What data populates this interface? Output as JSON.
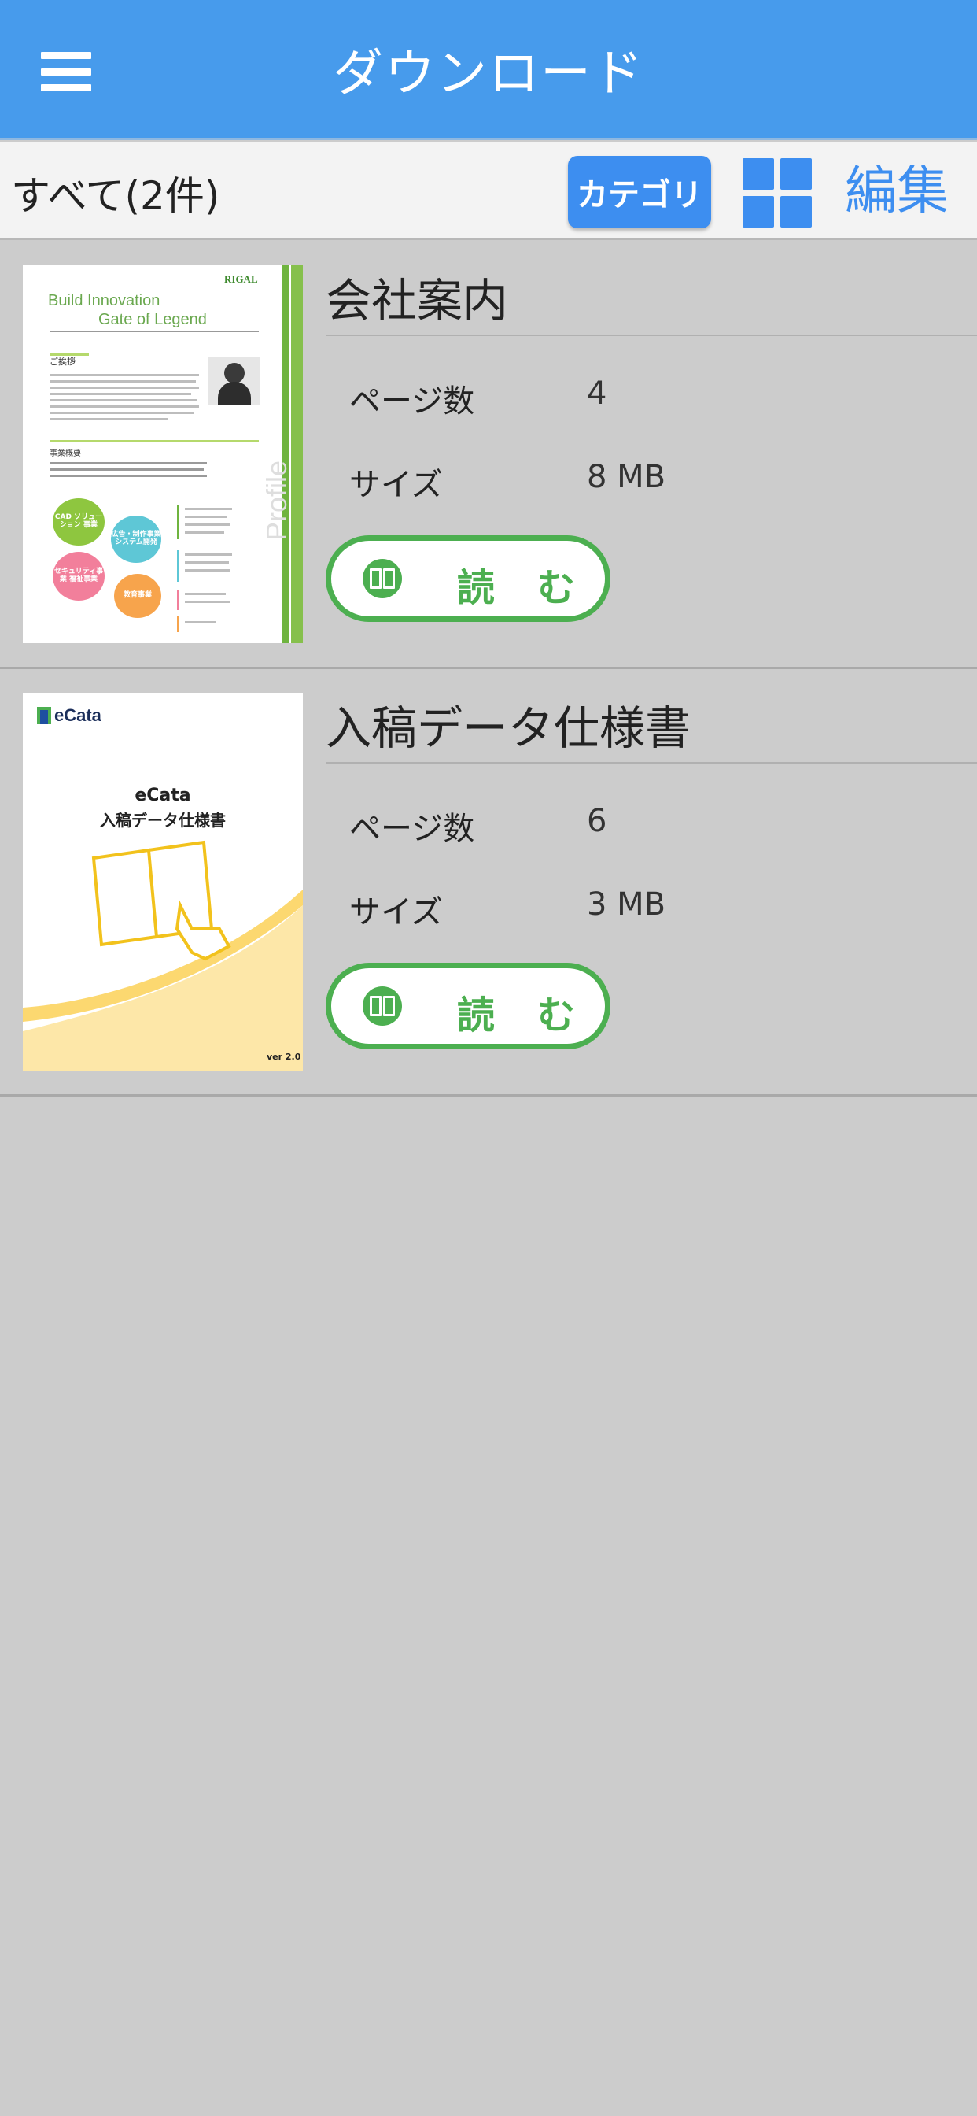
{
  "header": {
    "title": "ダウンロード",
    "menu_icon": "hamburger-menu-icon"
  },
  "toolbar": {
    "count_label": "すべて(2件)",
    "category_label": "カテゴリ",
    "grid_icon": "grid-view-icon",
    "edit_label": "編集"
  },
  "colors": {
    "header_bg": "#479bec",
    "accent_blue": "#3d8ef0",
    "read_green": "#4caf50",
    "background": "#cccccc"
  },
  "items": [
    {
      "title": "会社案内",
      "pages_label": "ページ数",
      "pages_value": "4",
      "size_label": "サイズ",
      "size_value": "8 MB",
      "read_icon": "book-icon",
      "read_char1": "読",
      "read_char2": "む",
      "thumb": {
        "logo": "RIGAL",
        "headline1": "Build Innovation",
        "headline2": "Gate of Legend",
        "greeting": "ご挨拶",
        "business": "事業概要",
        "circle1": "CAD ソリューション 事業",
        "circle2": "広告・制作事業 システム開発",
        "circle3": "セキュリティ事業 福祉事業",
        "circle4": "教育事業",
        "side": "Profile"
      }
    },
    {
      "title": "入稿データ仕様書",
      "pages_label": "ページ数",
      "pages_value": "6",
      "size_label": "サイズ",
      "size_value": "3 MB",
      "read_icon": "book-icon",
      "read_char1": "読",
      "read_char2": "む",
      "thumb": {
        "logo": "eCata",
        "name": "eCata",
        "doc_title": "入稿データ仕様書",
        "version": "ver 2.0"
      }
    }
  ]
}
